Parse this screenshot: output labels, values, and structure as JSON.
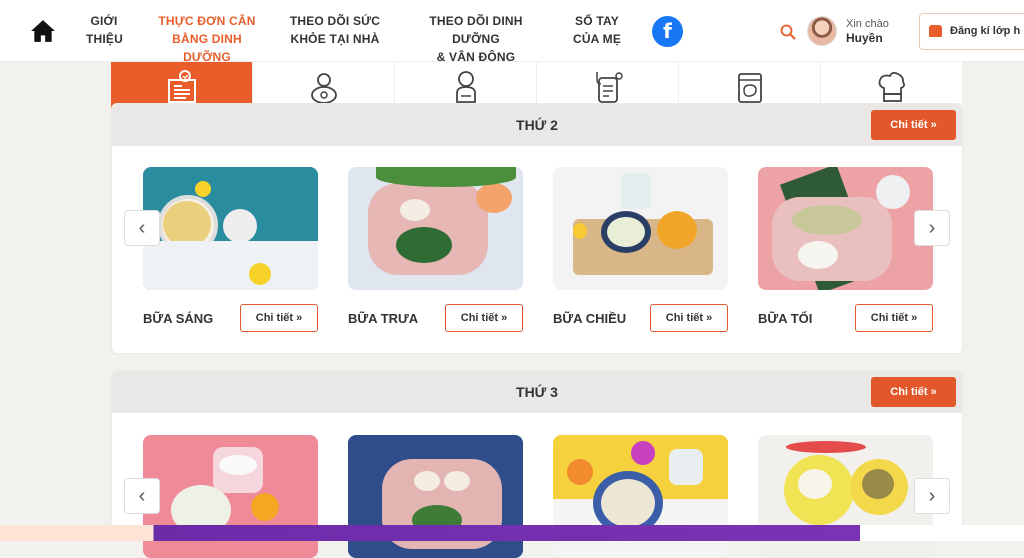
{
  "nav": {
    "items": [
      {
        "label_1": "GIỚI",
        "label_2": "THIỆU"
      },
      {
        "label_1": "THỰC ĐƠN CÂN",
        "label_2": "BẰNG DINH DƯỠNG"
      },
      {
        "label_1": "THEO DÕI SỨC",
        "label_2": "KHỎE TẠI NHÀ"
      },
      {
        "label_1": "THEO DÕI DINH DƯỠNG",
        "label_2": "& VẬN ĐỘNG"
      },
      {
        "label_1": "SỔ TAY",
        "label_2": "CỦA MẸ"
      }
    ],
    "facebook": "f",
    "greeting": "Xin chào",
    "user_name": "Huyền",
    "register_label": "Đăng kí lớp h",
    "accent": "#e85d2a"
  },
  "tabs": [
    "menu-icon",
    "baby-icon",
    "child-icon",
    "stethoscope-icon",
    "jar-icon",
    "chef-hat-icon"
  ],
  "sections": [
    {
      "day": "THỨ 2",
      "button": "Chi tiết »",
      "meals": [
        {
          "name": "BỮA SÁNG",
          "detail": "Chi tiết »"
        },
        {
          "name": "BỮA TRƯA",
          "detail": "Chi tiết »"
        },
        {
          "name": "BỮA CHIỀU",
          "detail": "Chi tiết »"
        },
        {
          "name": "BỮA TỐI",
          "detail": "Chi tiết »"
        }
      ]
    },
    {
      "day": "THỨ 3",
      "button": "Chi tiết »",
      "meals": []
    }
  ],
  "arrows": {
    "prev": "‹",
    "next": "›"
  }
}
